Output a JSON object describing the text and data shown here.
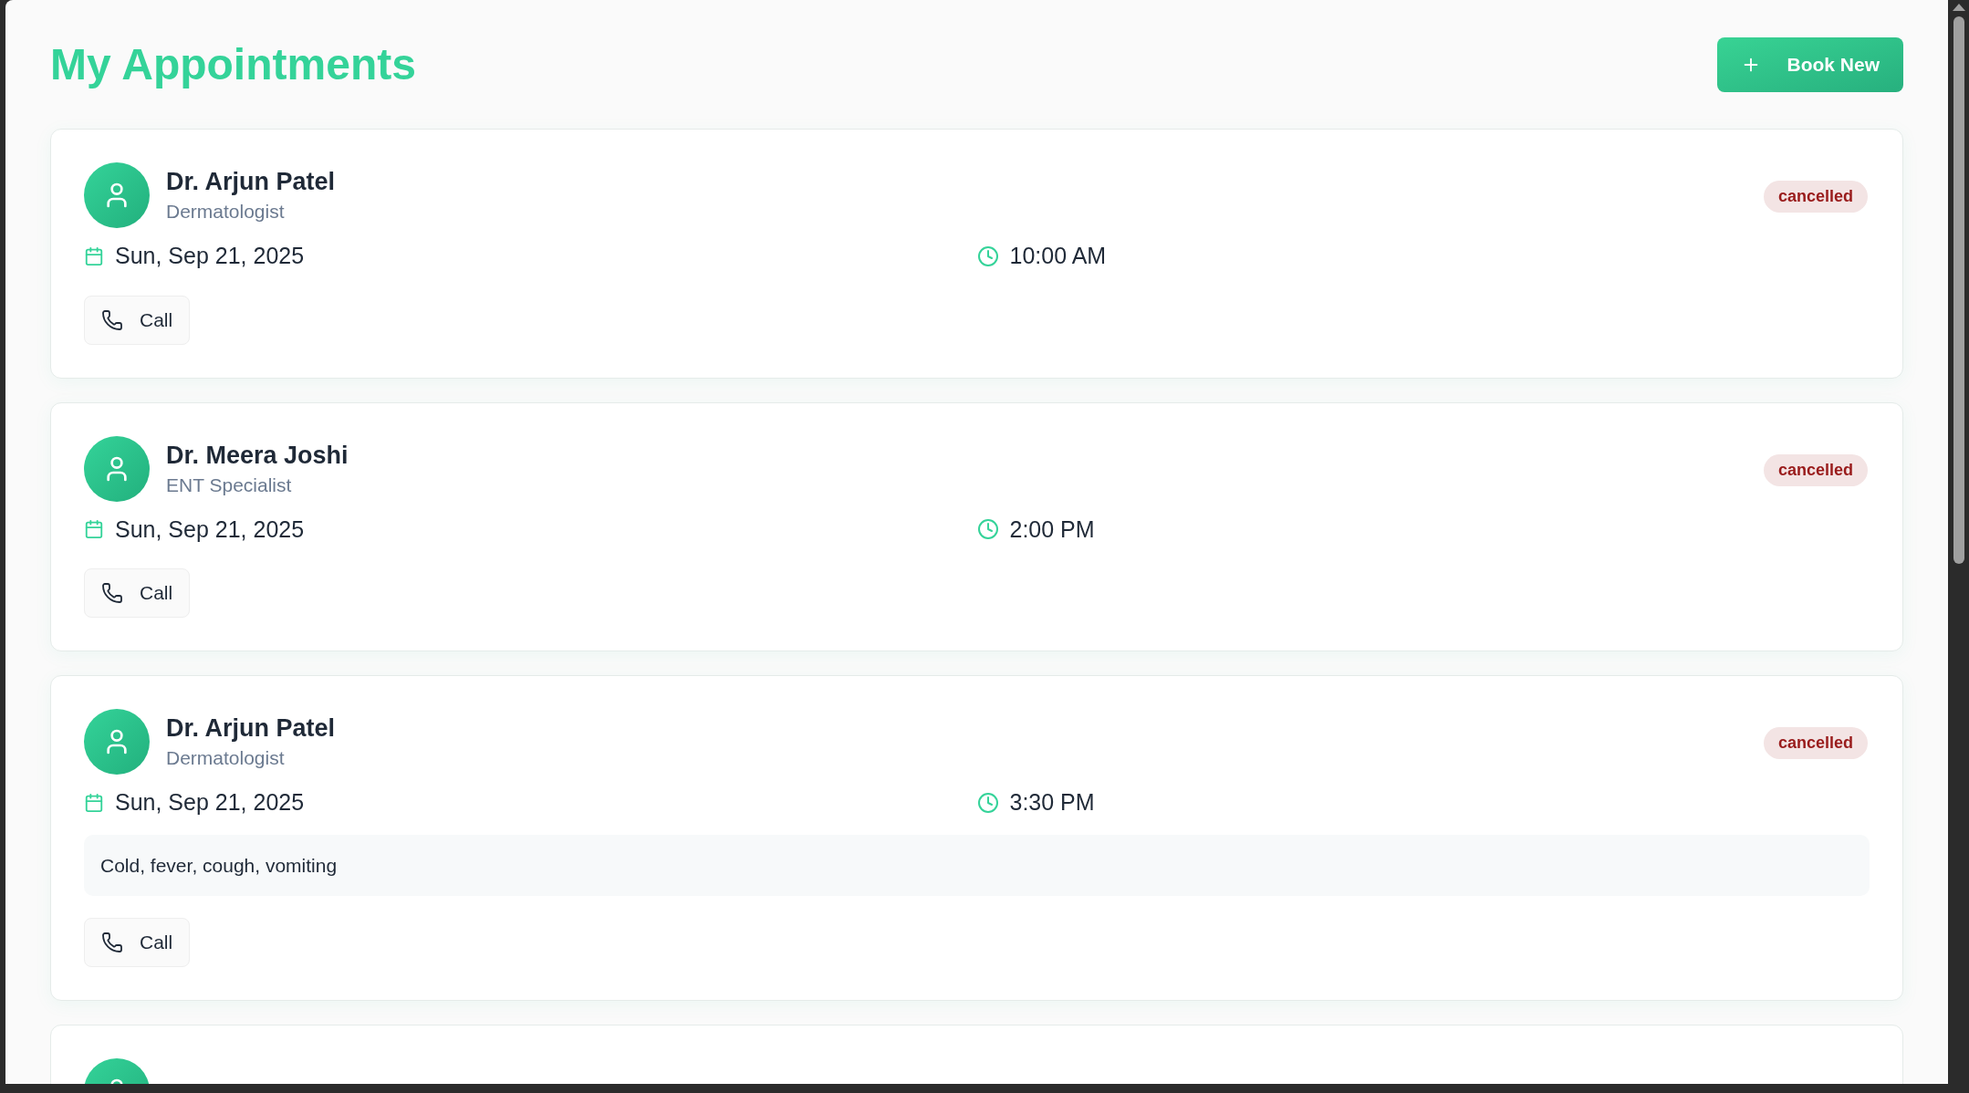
{
  "header": {
    "title": "My Appointments",
    "book_button": "Book New"
  },
  "appointments": [
    {
      "doctor": "Dr. Arjun Patel",
      "specialty": "Dermatologist",
      "date": "Sun, Sep 21, 2025",
      "time": "10:00 AM",
      "status": {
        "label": "cancelled",
        "color": "#991b1b"
      },
      "call_button": "Call"
    },
    {
      "doctor": "Dr. Meera Joshi",
      "specialty": "ENT Specialist",
      "date": "Sun, Sep 21, 2025",
      "time": "2:00 PM",
      "status": {
        "label": "cancelled",
        "color": "#991b1b"
      },
      "call_button": "Call"
    },
    {
      "doctor": "Dr. Arjun Patel",
      "specialty": "Dermatologist",
      "date": "Sun, Sep 21, 2025",
      "time": "3:30 PM",
      "status": {
        "label": "cancelled",
        "color": "#991b1b"
      },
      "notes": "Cold, fever, cough, vomiting",
      "call_button": "Call"
    }
  ],
  "more_below": true
}
